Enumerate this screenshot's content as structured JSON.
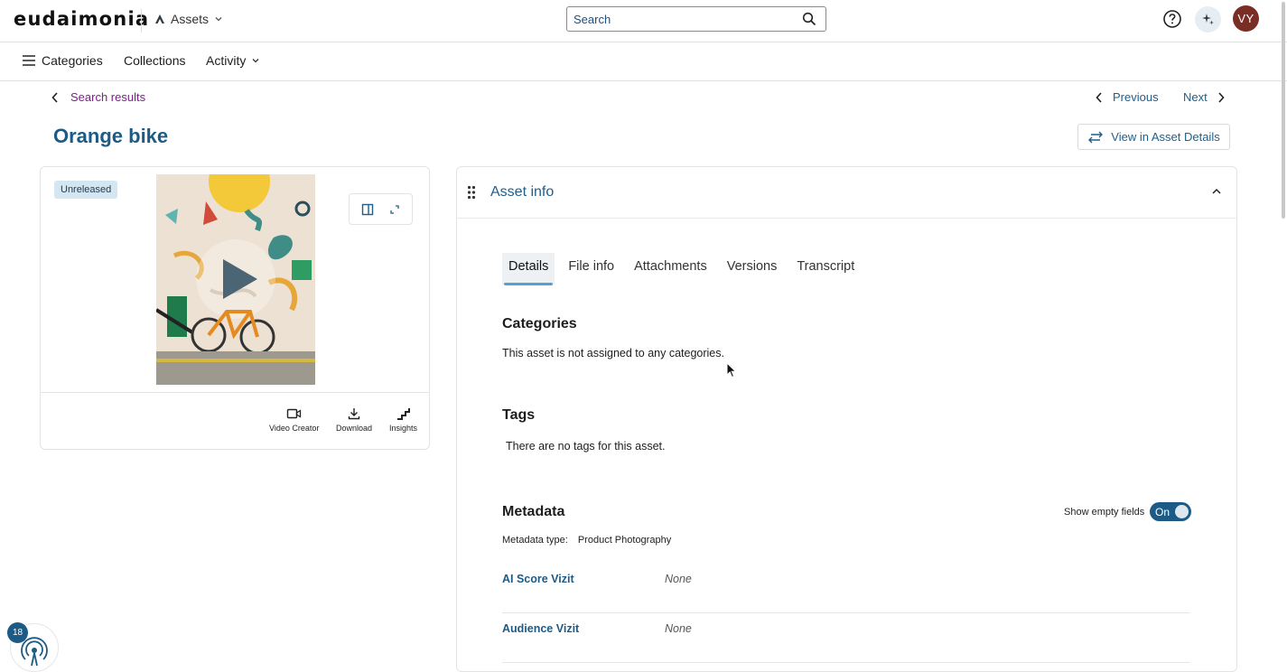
{
  "header": {
    "logo": "eudaimonia",
    "app_switch": "Assets",
    "search_placeholder": "Search",
    "avatar_initials": "VY"
  },
  "nav": {
    "menu_label": "Categories",
    "collections": "Collections",
    "activity": "Activity"
  },
  "breadcrumb": {
    "back_label": "Search results"
  },
  "pager": {
    "previous": "Previous",
    "next": "Next"
  },
  "asset": {
    "title": "Orange bike",
    "status_badge": "Unreleased",
    "view_details": "View in Asset Details"
  },
  "actions": [
    {
      "label": "Video Creator",
      "icon": "video-camera-icon"
    },
    {
      "label": "Download",
      "icon": "download-icon"
    },
    {
      "label": "Insights",
      "icon": "insights-icon"
    }
  ],
  "panel": {
    "title": "Asset info",
    "tabs": [
      "Details",
      "File info",
      "Attachments",
      "Versions",
      "Transcript"
    ],
    "active_tab": "Details"
  },
  "details": {
    "categories_heading": "Categories",
    "categories_text": "This asset is not assigned to any categories.",
    "tags_heading": "Tags",
    "tags_text": "There are no tags for this asset.",
    "metadata_heading": "Metadata",
    "show_empty_label": "Show empty fields",
    "show_empty_state": "On",
    "metadata_type_label": "Metadata type:",
    "metadata_type_value": "Product Photography",
    "fields": [
      {
        "name": "AI Score Vizit",
        "value": "None"
      },
      {
        "name": "Audience Vizit",
        "value": "None"
      }
    ]
  },
  "notification_count": "18",
  "colors": {
    "brand_blue": "#1c5b86",
    "link_purple": "#7a1f8b",
    "avatar": "#7a2d25",
    "tab_underline": "#4fa3d6"
  }
}
